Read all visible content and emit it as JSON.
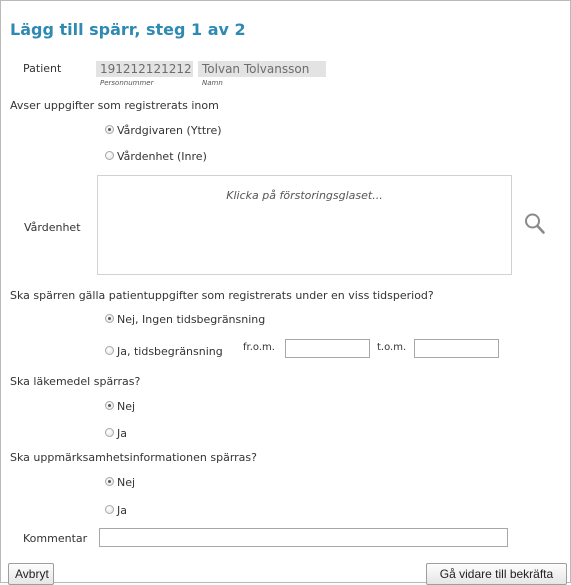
{
  "dialog": {
    "title": "Lägg till spärr, steg 1 av 2"
  },
  "patient": {
    "label": "Patient",
    "personnummer": "191212121212",
    "personnummer_caption": "Personnummer",
    "name": "Tolvan Tolvansson",
    "name_caption": "Namn"
  },
  "scope": {
    "question": "Avser uppgifter som registrerats inom",
    "options": [
      {
        "label": "Vårdgivaren (Yttre)",
        "checked": true
      },
      {
        "label": "Vårdenhet (Inre)",
        "checked": false
      }
    ]
  },
  "vardenhet": {
    "label": "Vårdenhet",
    "hint": "Klicka på förstoringsglaset...",
    "search_icon": "magnifier-icon"
  },
  "period": {
    "question": "Ska spärren gälla patientuppgifter som registrerats under en viss tidsperiod?",
    "options": [
      {
        "label": "Nej, Ingen tidsbegränsning",
        "checked": true
      },
      {
        "label": "Ja, tidsbegränsning",
        "checked": false
      }
    ],
    "from_label": "fr.o.m.",
    "from_value": "",
    "to_label": "t.o.m.",
    "to_value": ""
  },
  "medicine": {
    "question": "Ska läkemedel spärras?",
    "options": [
      {
        "label": "Nej",
        "checked": true
      },
      {
        "label": "Ja",
        "checked": false
      }
    ]
  },
  "attention": {
    "question": "Ska uppmärksamhetsinformationen spärras?",
    "options": [
      {
        "label": "Nej",
        "checked": true
      },
      {
        "label": "Ja",
        "checked": false
      }
    ]
  },
  "comment": {
    "label": "Kommentar",
    "value": ""
  },
  "buttons": {
    "cancel": "Avbryt",
    "next": "Gå vidare till bekräfta"
  }
}
